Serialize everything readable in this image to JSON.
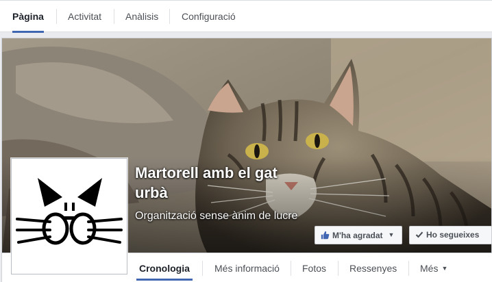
{
  "admin_tabs": [
    {
      "label": "Pàgina",
      "active": true
    },
    {
      "label": "Activitat",
      "active": false
    },
    {
      "label": "Anàlisis",
      "active": false
    },
    {
      "label": "Configuració",
      "active": false
    }
  ],
  "page": {
    "name": "Martorell amb el gat urbà",
    "category": "Organització sense ànim de lucre"
  },
  "actions": {
    "like_label": "M'ha agradat",
    "follow_label": "Ho segueixes"
  },
  "nav_tabs": [
    {
      "label": "Cronologia",
      "active": true
    },
    {
      "label": "Més informació",
      "active": false
    },
    {
      "label": "Fotos",
      "active": false
    },
    {
      "label": "Ressenyes",
      "active": false
    },
    {
      "label": "Més",
      "active": false
    }
  ],
  "colors": {
    "accent": "#4267b2",
    "like_icon": "#4267b2"
  }
}
